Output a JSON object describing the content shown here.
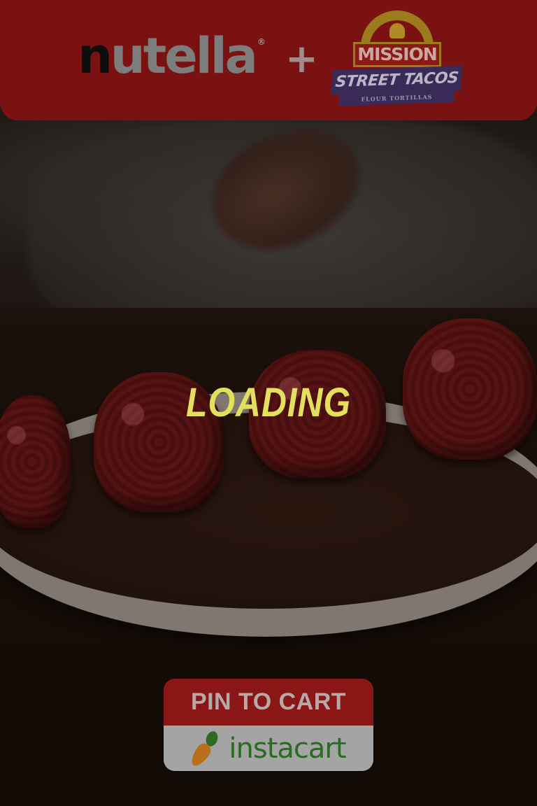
{
  "header": {
    "brand_left": {
      "letter_n": "n",
      "rest": "utella",
      "mark": "®"
    },
    "plus_symbol": "+",
    "brand_right": {
      "top": "MISSION",
      "middle": "STREET TACOS",
      "bottom": "FLOUR TORTILLAS"
    }
  },
  "status": {
    "text": "LOADING"
  },
  "cta": {
    "label": "PIN TO CART",
    "partner": "instacart"
  },
  "colors": {
    "banner": "#7a1212",
    "loading_text": "#e2e05c",
    "cta_top": "#8a1616",
    "cta_bottom": "#a4a4a4",
    "partner_text": "#2a6b22"
  },
  "icons": {
    "partner_logo": "carrot-icon"
  }
}
